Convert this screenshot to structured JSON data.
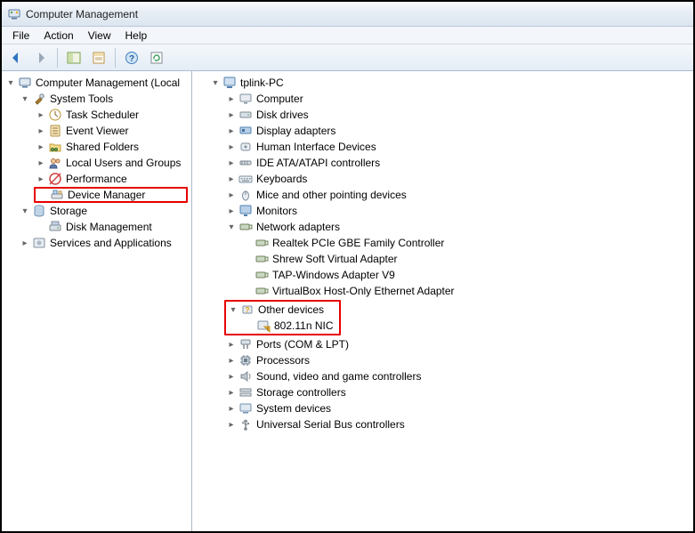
{
  "window": {
    "title": "Computer Management"
  },
  "menubar": {
    "file": "File",
    "action": "Action",
    "view": "View",
    "help": "Help"
  },
  "left_tree": {
    "root": "Computer Management (Local",
    "system_tools": "System Tools",
    "task_scheduler": "Task Scheduler",
    "event_viewer": "Event Viewer",
    "shared_folders": "Shared Folders",
    "local_users": "Local Users and Groups",
    "performance": "Performance",
    "device_manager": "Device Manager",
    "storage": "Storage",
    "disk_management": "Disk Management",
    "services": "Services and Applications"
  },
  "right_tree": {
    "root": "tplink-PC",
    "computer": "Computer",
    "disk_drives": "Disk drives",
    "display_adapters": "Display adapters",
    "hid": "Human Interface Devices",
    "ide": "IDE ATA/ATAPI controllers",
    "keyboards": "Keyboards",
    "mice": "Mice and other pointing devices",
    "monitors": "Monitors",
    "network_adapters": "Network adapters",
    "realtek": "Realtek PCIe GBE Family Controller",
    "shrew": "Shrew Soft Virtual Adapter",
    "tap": "TAP-Windows Adapter V9",
    "vbox": "VirtualBox Host-Only Ethernet Adapter",
    "other_devices": "Other devices",
    "nic": "802.11n NIC",
    "ports": "Ports (COM & LPT)",
    "processors": "Processors",
    "sound": "Sound, video and game controllers",
    "storage_ctrl": "Storage controllers",
    "system_devices": "System devices",
    "usb": "Universal Serial Bus controllers"
  }
}
